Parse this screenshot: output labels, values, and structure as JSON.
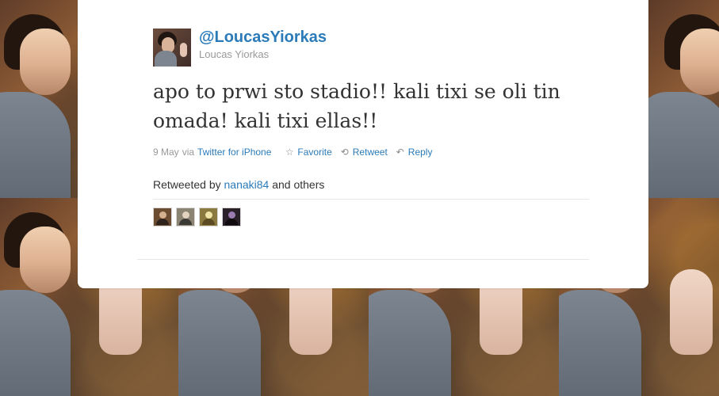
{
  "profile": {
    "handle": "@LoucasYiorkas",
    "name": "Loucas Yiorkas"
  },
  "tweet": {
    "text": "apo to prwi sto stadio!! kali tixi se oli tin omada! kali tixi ellas!!"
  },
  "meta": {
    "date": "9 May",
    "via": "via",
    "source": "Twitter for iPhone"
  },
  "actions": {
    "favorite": "Favorite",
    "retweet": "Retweet",
    "reply": "Reply"
  },
  "retweeted": {
    "prefix": "Retweeted by",
    "user": "nanaki84",
    "suffix": "and others"
  },
  "icons": {
    "favorite": "star-icon",
    "retweet": "retweet-icon",
    "reply": "reply-icon"
  },
  "colors": {
    "link": "#2b7bb9",
    "muted": "#999999",
    "text": "#333333",
    "card": "#ffffff",
    "background": "#4a3326"
  }
}
